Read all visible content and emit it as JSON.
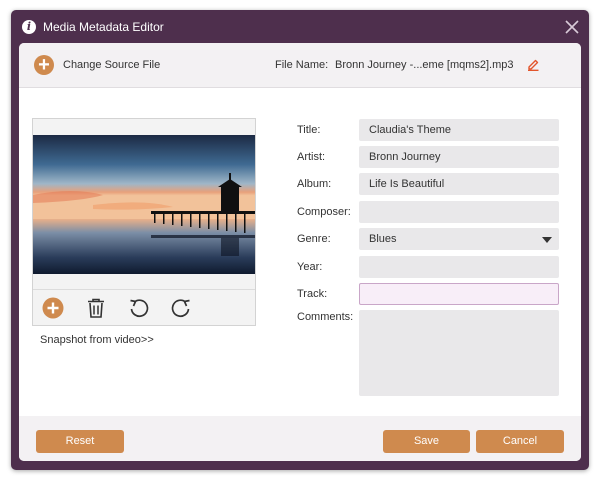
{
  "window": {
    "title": "Media Metadata Editor",
    "title_icon": "info-icon",
    "close_icon": "close-icon"
  },
  "header": {
    "change_source_label": "Change Source File",
    "file_name_label": "File Name:",
    "file_name_value": "Bronn Journey -...eme [mqms2].mp3"
  },
  "cover": {
    "toolbar": [
      "add-icon",
      "trash-icon",
      "rotate-left-icon",
      "rotate-right-icon"
    ],
    "snapshot_link": "Snapshot from video>>"
  },
  "fields": {
    "title": {
      "label": "Title:",
      "value": "Claudia's Theme"
    },
    "artist": {
      "label": "Artist:",
      "value": "Bronn Journey"
    },
    "album": {
      "label": "Album:",
      "value": "Life Is Beautiful"
    },
    "composer": {
      "label": "Composer:",
      "value": ""
    },
    "genre": {
      "label": "Genre:",
      "value": "Blues"
    },
    "year": {
      "label": "Year:",
      "value": ""
    },
    "track": {
      "label": "Track:",
      "value": ""
    },
    "comments": {
      "label": "Comments:",
      "value": ""
    }
  },
  "footer": {
    "reset_label": "Reset",
    "save_label": "Save",
    "cancel_label": "Cancel"
  },
  "colors": {
    "frame": "#4e2f4d",
    "accent": "#cf8a4e",
    "input_bg": "#e9e8ea",
    "active_border": "#c9a6c8"
  }
}
